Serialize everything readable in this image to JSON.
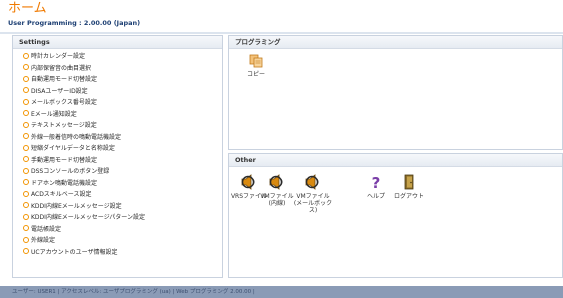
{
  "header": {
    "title": "ホーム",
    "subtitle": "User Programming : 2.00.00 (Japan)"
  },
  "settings": {
    "title": "Settings",
    "items": [
      "時計カレンダー設定",
      "内部保留音の曲目選択",
      "自動運用モード切替設定",
      "DISAユーザーID設定",
      "メールボックス番号設定",
      "Eメール通知設定",
      "テキストメッセージ設定",
      "外線一般着信時の鳴動電話機設定",
      "短縮ダイヤルデータと名称設定",
      "手動運用モード切替設定",
      "DSSコンソールのボタン登録",
      "ドアホン鳴動電話機設定",
      "ACDスキルベース設定",
      "KDDI内線Eメールメッセージ設定",
      "KDDI内線Eメールメッセージパターン設定",
      "電話帳設定",
      "外線設定",
      "UCアカウントのユーザ情報設定"
    ]
  },
  "programming": {
    "title": "プログラミング",
    "copy_label": "コピー"
  },
  "other": {
    "title": "Other",
    "tiles": [
      {
        "icon": "speaker-icon",
        "label": "VRSファイル"
      },
      {
        "icon": "speaker-icon",
        "label": "VMファイル\n(内線)"
      },
      {
        "icon": "speaker-icon",
        "label": "VMファイル\n(メールボック\nス)"
      },
      {
        "icon": "question-icon",
        "label": "ヘルプ"
      },
      {
        "icon": "logout-door-icon",
        "label": "ログアウト"
      }
    ]
  },
  "statusbar": {
    "text": "ユーザー: USER1 | アクセスレベル: ユーザプログラミング (ua) | Web プログラミング 2.00.00 |"
  },
  "colors": {
    "title_orange": "#f07a00",
    "subtitle_navy": "#1d3f73",
    "statusbar": "#8a9bb6"
  }
}
